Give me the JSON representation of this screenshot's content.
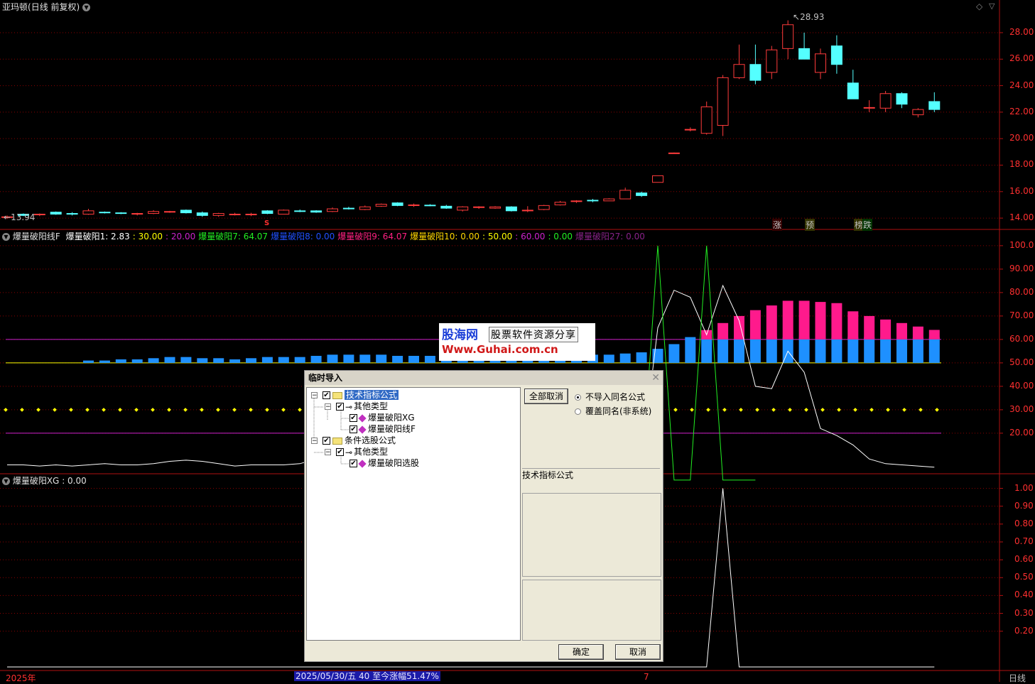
{
  "window": {
    "stock_title": "亚玛顿",
    "period_info": "(日线 前复权)",
    "period_name": "日线"
  },
  "colors": {
    "up": "#ff3b3b",
    "down": "#54ffff",
    "grid": "#8b0000",
    "panel_border": "#b01010",
    "axis_text": "#ff3030",
    "bar_blue": "#1e90ff",
    "bar_pink": "#ff1a8c",
    "line_white": "#ffffff",
    "line_green": "#22ee22",
    "dot_yellow": "#ffff00",
    "ref_magenta": "#cc22cc",
    "ref_yellow": "#ffff00"
  },
  "price_panel": {
    "y_ticks": [
      "28.00",
      "26.00",
      "24.00",
      "22.00",
      "20.00",
      "18.00",
      "16.00",
      "14.00"
    ],
    "high_label": "28.93",
    "low_label": "13.94",
    "markers": [
      {
        "text": "涨",
        "color": "#ff3030"
      },
      {
        "text": "预",
        "color": "#ffd700"
      },
      {
        "text": "榜",
        "color": "#ffd700"
      },
      {
        "text": "跌",
        "color": "#88ff88"
      }
    ],
    "bottom_mark": "S",
    "chart_data": {
      "type": "candlestick",
      "ylim": [
        13.2,
        29.5
      ],
      "candles": [
        {
          "o": 14.05,
          "h": 14.2,
          "l": 13.94,
          "c": 14.1,
          "dir": "up"
        },
        {
          "o": 14.3,
          "h": 14.35,
          "l": 14.15,
          "c": 14.2,
          "dir": "down"
        },
        {
          "o": 14.25,
          "h": 14.35,
          "l": 14.15,
          "c": 14.3,
          "dir": "up"
        },
        {
          "o": 14.45,
          "h": 14.5,
          "l": 14.25,
          "c": 14.3,
          "dir": "down"
        },
        {
          "o": 14.35,
          "h": 14.45,
          "l": 14.2,
          "c": 14.3,
          "dir": "down"
        },
        {
          "o": 14.3,
          "h": 14.7,
          "l": 14.25,
          "c": 14.55,
          "dir": "up"
        },
        {
          "o": 14.45,
          "h": 14.5,
          "l": 14.35,
          "c": 14.4,
          "dir": "down"
        },
        {
          "o": 14.4,
          "h": 14.45,
          "l": 14.3,
          "c": 14.38,
          "dir": "down"
        },
        {
          "o": 14.3,
          "h": 14.4,
          "l": 14.2,
          "c": 14.35,
          "dir": "up"
        },
        {
          "o": 14.35,
          "h": 14.6,
          "l": 14.3,
          "c": 14.5,
          "dir": "up"
        },
        {
          "o": 14.5,
          "h": 14.55,
          "l": 14.4,
          "c": 14.45,
          "dir": "up"
        },
        {
          "o": 14.6,
          "h": 14.65,
          "l": 14.35,
          "c": 14.4,
          "dir": "down"
        },
        {
          "o": 14.4,
          "h": 14.5,
          "l": 14.1,
          "c": 14.2,
          "dir": "down"
        },
        {
          "o": 14.2,
          "h": 14.4,
          "l": 14.1,
          "c": 14.35,
          "dir": "up"
        },
        {
          "o": 14.25,
          "h": 14.4,
          "l": 14.2,
          "c": 14.3,
          "dir": "up"
        },
        {
          "o": 14.3,
          "h": 14.4,
          "l": 14.15,
          "c": 14.3,
          "dir": "up"
        },
        {
          "o": 14.55,
          "h": 14.6,
          "l": 14.3,
          "c": 14.35,
          "dir": "down"
        },
        {
          "o": 14.3,
          "h": 14.65,
          "l": 14.3,
          "c": 14.6,
          "dir": "up"
        },
        {
          "o": 14.55,
          "h": 14.65,
          "l": 14.45,
          "c": 14.5,
          "dir": "down"
        },
        {
          "o": 14.45,
          "h": 14.6,
          "l": 14.4,
          "c": 14.55,
          "dir": "down"
        },
        {
          "o": 14.5,
          "h": 14.8,
          "l": 14.45,
          "c": 14.7,
          "dir": "up"
        },
        {
          "o": 14.75,
          "h": 14.85,
          "l": 14.65,
          "c": 14.7,
          "dir": "down"
        },
        {
          "o": 14.65,
          "h": 14.95,
          "l": 14.6,
          "c": 14.85,
          "dir": "up"
        },
        {
          "o": 14.9,
          "h": 15.1,
          "l": 14.85,
          "c": 15.05,
          "dir": "up"
        },
        {
          "o": 15.15,
          "h": 15.2,
          "l": 14.9,
          "c": 14.95,
          "dir": "down"
        },
        {
          "o": 14.95,
          "h": 15.1,
          "l": 14.85,
          "c": 15.0,
          "dir": "up"
        },
        {
          "o": 14.98,
          "h": 15.05,
          "l": 14.9,
          "c": 14.97,
          "dir": "down"
        },
        {
          "o": 14.9,
          "h": 15.0,
          "l": 14.7,
          "c": 14.75,
          "dir": "down"
        },
        {
          "o": 14.6,
          "h": 14.9,
          "l": 14.5,
          "c": 14.85,
          "dir": "up"
        },
        {
          "o": 14.8,
          "h": 14.9,
          "l": 14.7,
          "c": 14.85,
          "dir": "up"
        },
        {
          "o": 14.85,
          "h": 14.9,
          "l": 14.7,
          "c": 14.75,
          "dir": "up"
        },
        {
          "o": 14.85,
          "h": 14.9,
          "l": 14.5,
          "c": 14.55,
          "dir": "down"
        },
        {
          "o": 14.55,
          "h": 14.9,
          "l": 14.45,
          "c": 14.6,
          "dir": "up"
        },
        {
          "o": 14.65,
          "h": 15.0,
          "l": 14.6,
          "c": 14.95,
          "dir": "up"
        },
        {
          "o": 15.0,
          "h": 15.3,
          "l": 14.95,
          "c": 15.2,
          "dir": "up"
        },
        {
          "o": 15.25,
          "h": 15.35,
          "l": 15.15,
          "c": 15.3,
          "dir": "up"
        },
        {
          "o": 15.3,
          "h": 15.45,
          "l": 15.2,
          "c": 15.35,
          "dir": "down"
        },
        {
          "o": 15.3,
          "h": 15.5,
          "l": 15.3,
          "c": 15.45,
          "dir": "up"
        },
        {
          "o": 15.45,
          "h": 16.3,
          "l": 15.45,
          "c": 16.1,
          "dir": "up"
        },
        {
          "o": 15.9,
          "h": 16.0,
          "l": 15.6,
          "c": 15.7,
          "dir": "down"
        },
        {
          "o": 16.7,
          "h": 17.2,
          "l": 16.7,
          "c": 17.2,
          "dir": "up"
        },
        {
          "o": 18.9,
          "h": 18.95,
          "l": 18.9,
          "c": 18.92,
          "dir": "up"
        },
        {
          "o": 20.7,
          "h": 20.85,
          "l": 20.55,
          "c": 20.7,
          "dir": "up"
        },
        {
          "o": 20.4,
          "h": 22.8,
          "l": 20.3,
          "c": 22.4,
          "dir": "up"
        },
        {
          "o": 21.0,
          "h": 24.8,
          "l": 20.2,
          "c": 24.6,
          "dir": "up"
        },
        {
          "o": 24.6,
          "h": 27.1,
          "l": 24.5,
          "c": 25.6,
          "dir": "up"
        },
        {
          "o": 25.6,
          "h": 27.1,
          "l": 24.1,
          "c": 24.4,
          "dir": "down"
        },
        {
          "o": 25.0,
          "h": 27.0,
          "l": 24.5,
          "c": 26.7,
          "dir": "up"
        },
        {
          "o": 26.8,
          "h": 28.93,
          "l": 26.0,
          "c": 28.6,
          "dir": "up"
        },
        {
          "o": 26.8,
          "h": 28.0,
          "l": 26.0,
          "c": 26.0,
          "dir": "down"
        },
        {
          "o": 25.0,
          "h": 26.8,
          "l": 24.5,
          "c": 26.4,
          "dir": "up"
        },
        {
          "o": 27.0,
          "h": 27.8,
          "l": 24.9,
          "c": 25.6,
          "dir": "down"
        },
        {
          "o": 24.2,
          "h": 25.2,
          "l": 23.0,
          "c": 23.0,
          "dir": "down"
        },
        {
          "o": 22.3,
          "h": 22.9,
          "l": 22.0,
          "c": 22.35,
          "dir": "up"
        },
        {
          "o": 22.3,
          "h": 23.6,
          "l": 22.0,
          "c": 23.4,
          "dir": "up"
        },
        {
          "o": 23.4,
          "h": 23.5,
          "l": 22.3,
          "c": 22.6,
          "dir": "down"
        },
        {
          "o": 21.8,
          "h": 22.3,
          "l": 21.6,
          "c": 22.2,
          "dir": "up"
        },
        {
          "o": 22.8,
          "h": 23.5,
          "l": 22.0,
          "c": 22.2,
          "dir": "down"
        }
      ]
    }
  },
  "indicator_panel": {
    "name": "爆量破阳线F",
    "legend": [
      {
        "text": "爆量破阳1: 2.83",
        "color": "#ffffff"
      },
      {
        "text": ": 30.00",
        "color": "#ffff00"
      },
      {
        "text": ": 20.00",
        "color": "#cc22cc"
      },
      {
        "text": "爆量破阳7: 64.07",
        "color": "#22ee22"
      },
      {
        "text": "爆量破阳8: 0.00",
        "color": "#2050ff"
      },
      {
        "text": "爆量破阳9: 64.07",
        "color": "#ff2080"
      },
      {
        "text": "爆量破阳10: 0.00",
        "color": "#ffd700"
      },
      {
        "text": ": 50.00",
        "color": "#ffff00"
      },
      {
        "text": ": 60.00",
        "color": "#cc22cc"
      },
      {
        "text": ": 0.00",
        "color": "#22ee22"
      },
      {
        "text": "爆量破阳27: 0.00",
        "color": "#882288"
      }
    ],
    "y_ticks": [
      "100.0",
      "90.00",
      "80.00",
      "70.00",
      "60.00",
      "50.00",
      "40.00",
      "30.00",
      "20.00"
    ],
    "chart_data": {
      "type": "bar",
      "ylim": [
        3,
        103
      ],
      "reference_lines": [
        60,
        50,
        20
      ],
      "dots_level": 30,
      "blue_bars": [
        0,
        0,
        0,
        0,
        0,
        51,
        51,
        51.5,
        51.5,
        52,
        52.5,
        52.5,
        52,
        52,
        51.5,
        52,
        52.5,
        52.5,
        52.5,
        53,
        53.5,
        53.5,
        53.5,
        53.5,
        53,
        53,
        53,
        52.5,
        52,
        52.5,
        52,
        52,
        52.5,
        53,
        53,
        53,
        53.5,
        53.5,
        54,
        54.5,
        56,
        58,
        61,
        61,
        61,
        61,
        61,
        61,
        61,
        61,
        61,
        61,
        61,
        61,
        61,
        61,
        61,
        61
      ],
      "pink_bars": [
        0,
        0,
        0,
        0,
        0,
        0,
        0,
        0,
        0,
        0,
        0,
        0,
        0,
        0,
        0,
        0,
        0,
        0,
        0,
        0,
        0,
        0,
        0,
        0,
        0,
        0,
        0,
        0,
        0,
        0,
        0,
        0,
        0,
        0,
        0,
        0,
        0,
        0,
        0,
        0,
        0,
        0,
        0,
        64,
        67,
        70,
        72.5,
        74.5,
        76.5,
        76.5,
        76,
        75.5,
        72,
        70,
        68.5,
        67,
        65.5,
        64.07
      ],
      "white_line": [
        6.5,
        6.5,
        6,
        6.5,
        6,
        6.5,
        7,
        6.5,
        6.5,
        7,
        8,
        8.5,
        8,
        7,
        6,
        6.5,
        6.5,
        6.5,
        7,
        9,
        8,
        7,
        7,
        6.5,
        7,
        6,
        6,
        7,
        8,
        9,
        9.5,
        9.5,
        8,
        7,
        6.5,
        7,
        6.5,
        6.5,
        7,
        7.5,
        65,
        81,
        78,
        62,
        83,
        68,
        40,
        39,
        55,
        46,
        22,
        19,
        15,
        9,
        7,
        6.5,
        6,
        5.5
      ],
      "green_line": [
        0,
        0,
        0,
        0,
        0,
        0,
        0,
        0,
        0,
        0,
        0,
        0,
        0,
        0,
        0,
        0,
        0,
        0,
        0,
        0,
        0,
        0,
        0,
        0,
        0,
        0,
        0,
        0,
        0,
        0,
        0,
        0,
        0,
        0,
        0,
        0,
        0,
        0,
        0,
        0,
        100,
        0,
        0,
        100,
        0,
        0,
        0,
        0,
        0,
        0,
        0,
        0,
        0,
        0,
        0,
        0,
        0,
        0
      ]
    }
  },
  "signal_panel": {
    "name": "爆量破阳XG",
    "value": ": 0.00",
    "y_ticks": [
      "1.00",
      "0.90",
      "0.80",
      "0.70",
      "0.60",
      "0.50",
      "0.40",
      "0.30",
      "0.20"
    ],
    "chart_data": {
      "type": "line",
      "ylim": [
        -0.02,
        1.03
      ],
      "values": [
        0,
        0,
        0,
        0,
        0,
        0,
        0,
        0,
        0,
        0,
        0,
        0,
        0,
        0,
        0,
        0,
        0,
        0,
        0,
        0,
        0,
        0,
        0,
        0,
        0,
        0,
        0,
        0,
        0,
        0,
        0,
        0,
        0,
        0,
        0,
        0,
        0,
        0,
        0,
        0,
        0,
        0,
        0,
        0,
        1,
        0,
        0,
        0,
        0,
        0,
        0,
        0,
        0,
        0,
        0,
        0,
        0,
        0
      ]
    }
  },
  "bottom_bar": {
    "year": "2025年",
    "range_info": "2025/05/30/五  40 至今涨幅51.47%",
    "mark": "7"
  },
  "watermark": {
    "brand": "股海网",
    "slogan": "股票软件资源分享",
    "url": "Www.Guhai.com.cn"
  },
  "dialog": {
    "title": "临时导入",
    "tree": [
      {
        "label": "技术指标公式",
        "level": 0,
        "selected": true
      },
      {
        "label": "其他类型",
        "level": 1
      },
      {
        "label": "爆量破阳XG",
        "level": 2
      },
      {
        "label": "爆量破阳线F",
        "level": 2
      },
      {
        "label": "条件选股公式",
        "level": 0
      },
      {
        "label": "其他类型",
        "level": 1
      },
      {
        "label": "爆量破阳选股",
        "level": 2
      }
    ],
    "clear_all_button": "全部取消",
    "radio_no_import": "不导入同名公式",
    "radio_overwrite": "覆盖同名(非系统)",
    "category_label": "技术指标公式",
    "ok_button": "确定",
    "cancel_button": "取消"
  }
}
